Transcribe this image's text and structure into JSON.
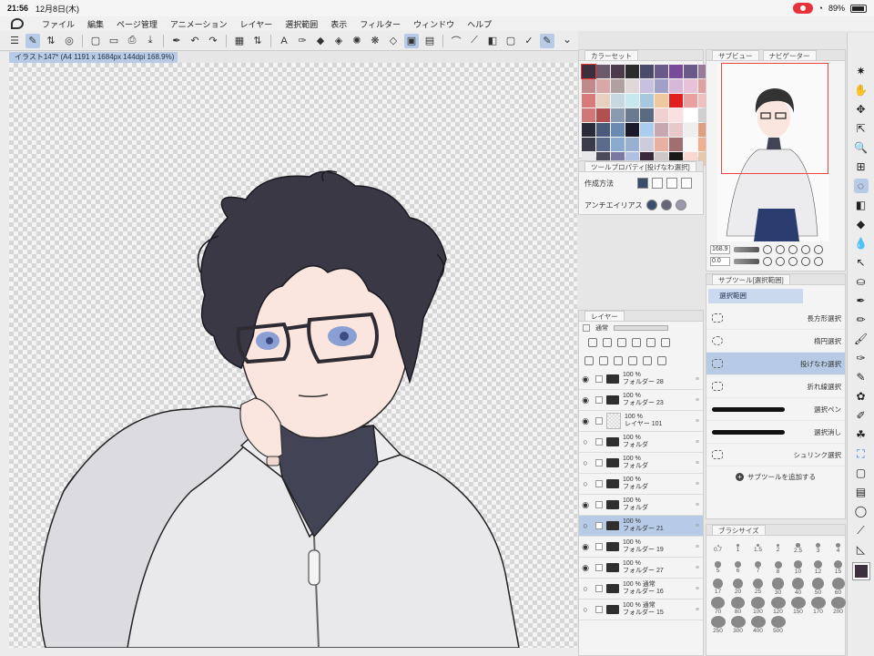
{
  "status": {
    "time": "21:56",
    "date": "12月8日(木)",
    "battery": "89%"
  },
  "menu": [
    "ファイル",
    "編集",
    "ページ管理",
    "アニメーション",
    "レイヤー",
    "選択範囲",
    "表示",
    "フィルター",
    "ウィンドウ",
    "ヘルプ"
  ],
  "toolbar": {
    "icons": [
      "hamburger-icon",
      "pen-select-icon",
      "chevron-ud-icon",
      "target-icon",
      "new-page-icon",
      "open-folder-icon",
      "print-icon",
      "save-icon",
      "eyedropper-icon",
      "undo-icon",
      "redo-icon",
      "transform-icon",
      "chevron-ud-icon",
      "text-icon",
      "pen-icon",
      "fill-icon",
      "eraser-icon",
      "lasso-icon",
      "sparkle-icon",
      "bucket-icon",
      "select-rect-icon",
      "select-rect2-icon",
      "bezier-icon",
      "ruler-icon",
      "gradient-icon",
      "frame-icon",
      "check-icon",
      "brush-icon"
    ],
    "glyphs": [
      "☰",
      "✎",
      "⇅",
      "◎",
      "▢",
      "▭",
      "⎙",
      "⤓",
      "✒",
      "↶",
      "↷",
      "▦",
      "⇅",
      "A",
      "✑",
      "◆",
      "◈",
      "✺",
      "❋",
      "◇",
      "▣",
      "▤",
      "⌒",
      "⟋",
      "◧",
      "▢",
      "✓",
      "✎"
    ],
    "active": [
      1,
      20,
      27
    ],
    "chevron": "⌄"
  },
  "document": {
    "tab": "イラスト147* (A4 1191 x 1684px 144dpi 168.9%)"
  },
  "color_panel": {
    "header_tab": "カラーセット",
    "swatches": [
      "#3a2f3a",
      "#6b5a6b",
      "#4b3b4b",
      "#2c2c2c",
      "#4a4a6a",
      "#6a5a8a",
      "#7a4a9a",
      "#6a5a8a",
      "#9a7a9a",
      "#c08a8a",
      "#d8a8a8",
      "#b0a0a0",
      "#e0d8d8",
      "#c8c0e0",
      "#a0a0c8",
      "#d8b8d8",
      "#e8c0d8",
      "#e0a0a0",
      "#d87a7a",
      "#e8d0c0",
      "#c8d8e0",
      "#c8e8f0",
      "#a8c8e0",
      "#f0c8a0",
      "#e02020",
      "#e8a0a0",
      "#f0c0c0",
      "#d07878",
      "#b05050",
      "#8a9ab0",
      "#6a7a90",
      "#5a6a80",
      "#f0d0d0",
      "#f8e0e0",
      "#ffffff",
      "#d0d0d0",
      "#2a2a3a",
      "#4a5a7a",
      "#6a8ab0",
      "#1a1a2a",
      "#aaccee",
      "#c8a8b0",
      "#e8c8c8",
      "#eeeeee",
      "#e0a080",
      "#3a3a4a",
      "#5a6a8a",
      "#8aaad0",
      "#9ab0d0",
      "#ccccdd",
      "#e8b0a0",
      "#a07070",
      "#f8f8f8",
      "#f0b090",
      "#e8e8e8",
      "#4a4a5a",
      "#7a7aa0",
      "#b0c0e0",
      "#3a2a3a",
      "#d0c8c8",
      "#1a1a1a",
      "#f8d8d0",
      "#e8c8a8"
    ]
  },
  "tool_prop": {
    "header_tab": "ツールプロパティ[投げなわ選択]",
    "mode_label": "作成方法",
    "aa_label": "アンチエイリアス"
  },
  "navigator": {
    "tabs": [
      "サブビュー",
      "ナビゲーター"
    ],
    "zoom": "168.9",
    "angle": "0.0"
  },
  "subtool": {
    "header_tab": "サブツール[選択範囲]",
    "group": "選択範囲",
    "items": [
      "長方形選択",
      "楕円選択",
      "投げなわ選択",
      "折れ線選択",
      "選択ペン",
      "選択消し",
      "シュリンク選択"
    ],
    "selected_index": 2,
    "add_label": "サブツールを追加する"
  },
  "brush_size": {
    "header_tab": "ブラシサイズ",
    "sizes": [
      "0.7",
      "1",
      "1.5",
      "2",
      "2.5",
      "3",
      "4",
      "5",
      "6",
      "7",
      "8",
      "10",
      "12",
      "15",
      "17",
      "20",
      "25",
      "30",
      "40",
      "50",
      "60",
      "70",
      "80",
      "100",
      "120",
      "150",
      "170",
      "200",
      "250",
      "300",
      "400",
      "500"
    ]
  },
  "layers": {
    "header_tab": "レイヤー",
    "blend": "通常",
    "rows": [
      {
        "opacity": "100 %",
        "name": "フォルダー 28",
        "type": "folder",
        "eye": true,
        "selected": false
      },
      {
        "opacity": "100 %",
        "name": "フォルダー 23",
        "type": "folder-open",
        "eye": true,
        "selected": false
      },
      {
        "opacity": "100 %",
        "name": "レイヤー 101",
        "type": "layer",
        "eye": true,
        "selected": false
      },
      {
        "opacity": "100 %",
        "name": "フォルダ",
        "type": "folder",
        "eye": false,
        "selected": false
      },
      {
        "opacity": "100 %",
        "name": "フォルダ",
        "type": "folder",
        "eye": false,
        "selected": false
      },
      {
        "opacity": "100 %",
        "name": "フォルダ",
        "type": "folder",
        "eye": false,
        "selected": false
      },
      {
        "opacity": "100 %",
        "name": "フォルダ",
        "type": "folder",
        "eye": true,
        "selected": false
      },
      {
        "opacity": "100 %",
        "name": "フォルダー 21",
        "type": "folder",
        "eye": false,
        "selected": true
      },
      {
        "opacity": "100 %",
        "name": "フォルダー 19",
        "type": "folder",
        "eye": true,
        "selected": false
      },
      {
        "opacity": "100 %",
        "name": "フォルダー 27",
        "type": "folder",
        "eye": true,
        "selected": false
      },
      {
        "opacity": "100 % 通常",
        "name": "フォルダー 16",
        "type": "folder",
        "eye": false,
        "selected": false
      },
      {
        "opacity": "100 % 通常",
        "name": "フォルダー 15",
        "type": "folder",
        "eye": false,
        "selected": false
      }
    ]
  },
  "right_tools": {
    "names": [
      "sparkle-tool-icon",
      "hand-tool-icon",
      "move-tool-icon",
      "select-move-icon",
      "zoom-tool-icon",
      "layer-move-icon",
      "lasso-tool-icon",
      "eraser-tool-icon",
      "fill-tool-icon",
      "drop-tool-icon",
      "operation-tool-icon",
      "stamp-tool-icon",
      "pen-tool-icon",
      "pencil-tool-icon",
      "brush-tool-icon",
      "airbrush-tool-icon",
      "marker-tool-icon",
      "decor-tool-icon",
      "wand-tool-icon",
      "blend-tool-icon",
      "puzzle-tool-icon",
      "figure-tool-icon",
      "gradient-tool-icon",
      "balloon-tool-icon",
      "ruler-tool-icon",
      "frame-tool-icon"
    ],
    "glyphs": [
      "✷",
      "✋",
      "✥",
      "⇱",
      "🔍",
      "⊞",
      "◌",
      "◧",
      "◆",
      "💧",
      "↖",
      "⛀",
      "✒",
      "✏",
      "🖌",
      "✑",
      "✎",
      "✿",
      "✐",
      "☘",
      "⛶",
      "▢",
      "▤",
      "◯",
      "⟋",
      "◺"
    ],
    "selected": 6,
    "blue": 20,
    "main_color": "#3d2f3b"
  }
}
